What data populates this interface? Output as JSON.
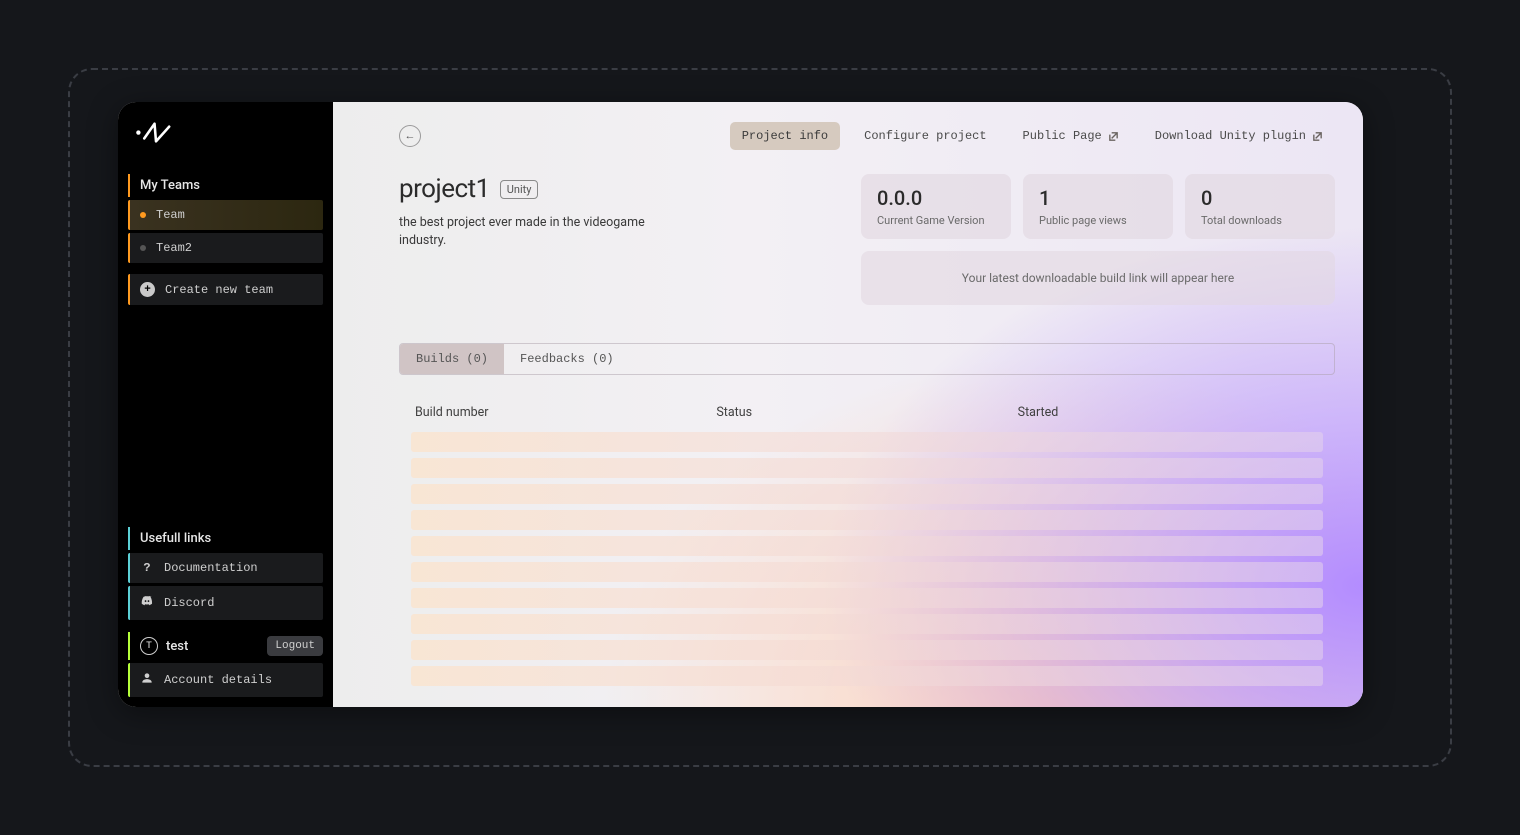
{
  "sidebar": {
    "teams_heading": "My Teams",
    "teams": [
      {
        "label": "Team",
        "active": true
      },
      {
        "label": "Team2",
        "active": false
      }
    ],
    "create_team_label": "Create new team",
    "links_heading": "Usefull links",
    "links": [
      {
        "label": "Documentation",
        "icon": "question"
      },
      {
        "label": "Discord",
        "icon": "discord"
      }
    ],
    "account": {
      "username": "test",
      "badge_letter": "T",
      "logout_label": "Logout",
      "details_label": "Account details"
    }
  },
  "topnav": {
    "items": [
      {
        "label": "Project info",
        "active": true,
        "external": false
      },
      {
        "label": "Configure project",
        "active": false,
        "external": false
      },
      {
        "label": "Public Page",
        "active": false,
        "external": true
      },
      {
        "label": "Download Unity plugin",
        "active": false,
        "external": true
      }
    ]
  },
  "project": {
    "name": "project1",
    "engine": "Unity",
    "description": "the best project ever made in the videogame industry.",
    "stats": [
      {
        "value": "0.0.0",
        "label": "Current Game Version"
      },
      {
        "value": "1",
        "label": "Public page views"
      },
      {
        "value": "0",
        "label": "Total downloads"
      }
    ],
    "build_banner": "Your latest downloadable build link will appear here"
  },
  "tabs": [
    {
      "label": "Builds (0)",
      "active": true
    },
    {
      "label": "Feedbacks (0)",
      "active": false
    }
  ],
  "builds_table": {
    "columns": [
      "Build number",
      "Status",
      "Started"
    ],
    "placeholder_rows": 10
  }
}
